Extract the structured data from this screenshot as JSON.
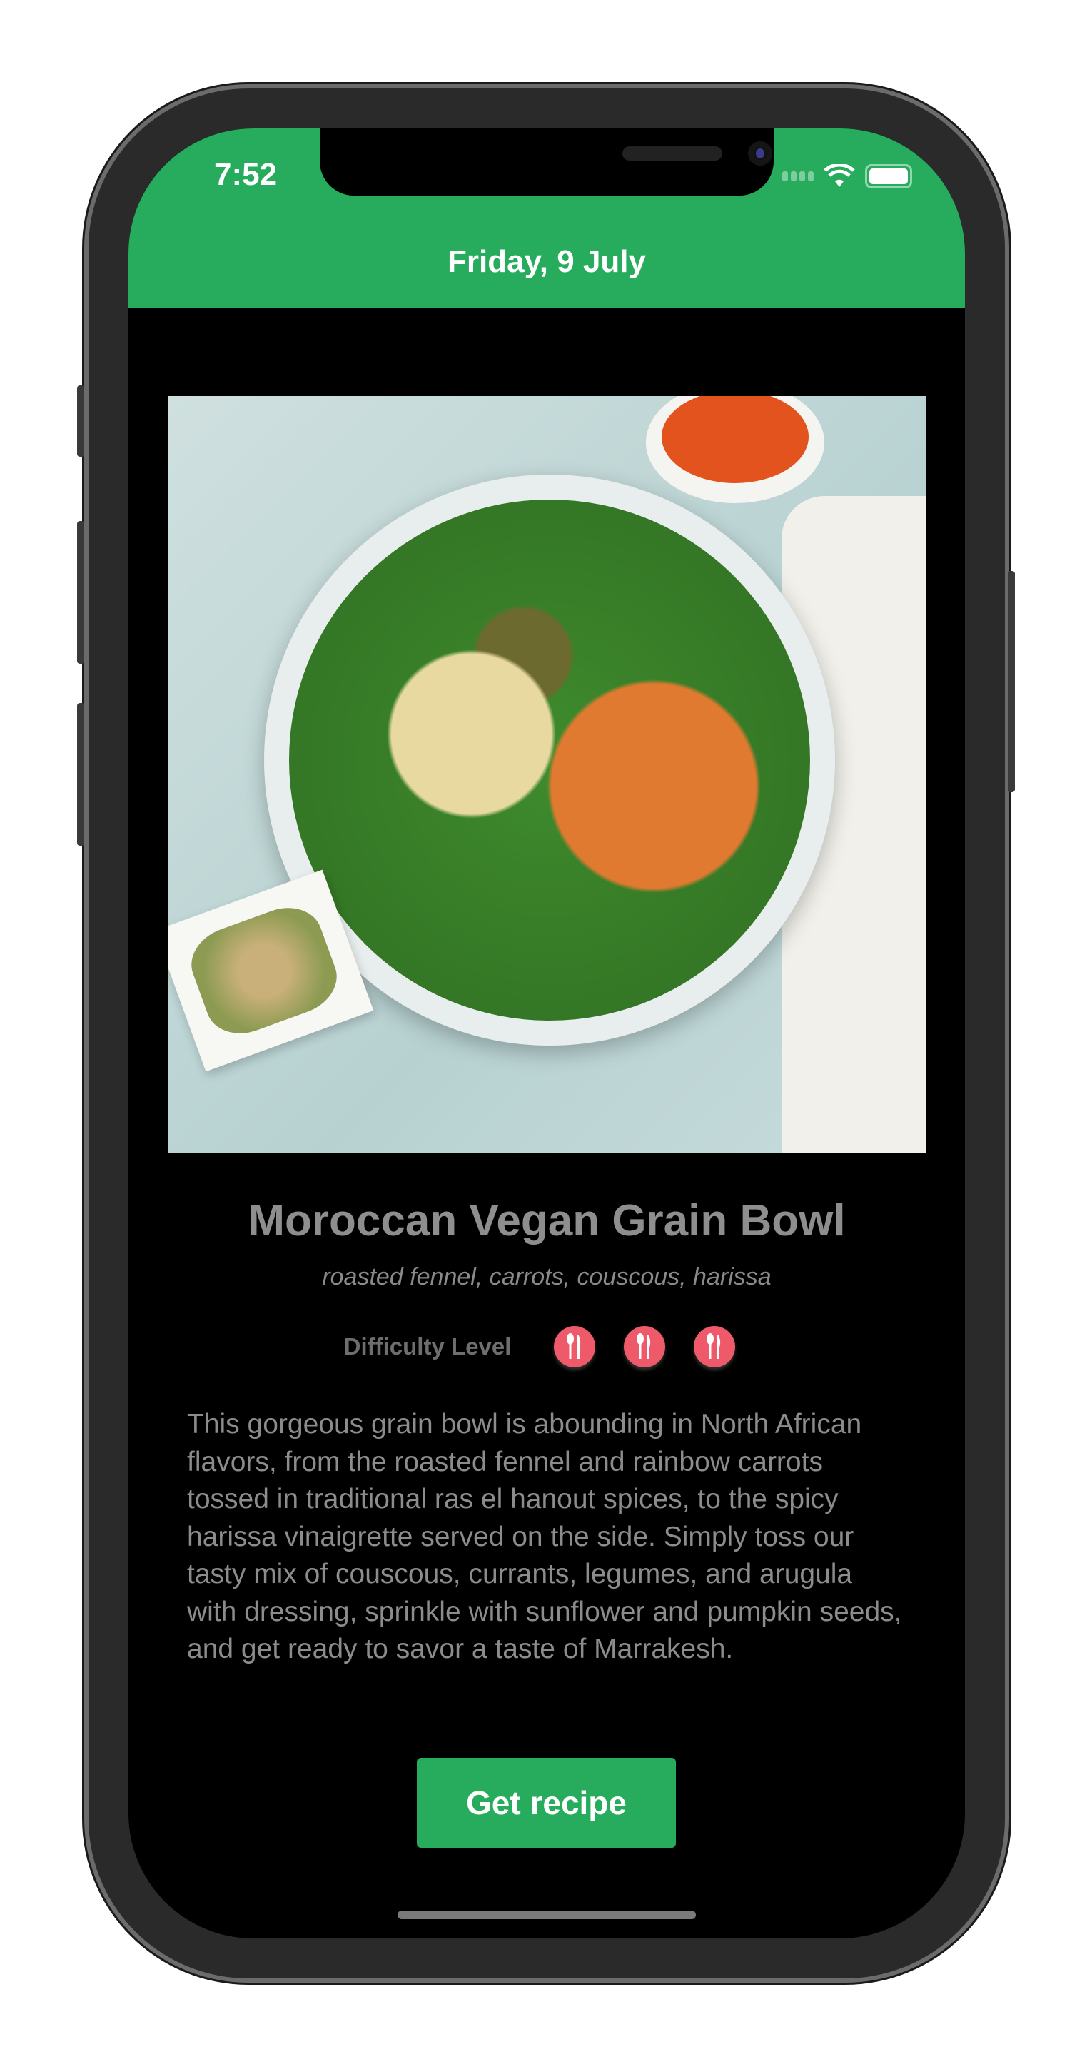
{
  "status_bar": {
    "time": "7:52"
  },
  "header": {
    "date": "Friday, 9 July"
  },
  "recipe": {
    "title": "Moroccan Vegan Grain Bowl",
    "subtitle": "roasted fennel, carrots, couscous, harissa",
    "difficulty_label": "Difficulty Level",
    "difficulty_level": 3,
    "difficulty_max": 3,
    "description": "This gorgeous grain bowl is abounding in North African flavors, from the roasted fennel and rainbow carrots tossed in traditional ras el hanout spices, to the spicy harissa vinaigrette served on the side. Simply toss our tasty mix of couscous, currants, legumes, and arugula with dressing, sprinkle with sunflower and pumpkin seeds, and get ready to savor a taste of Marrakesh.",
    "cta_label": "Get recipe"
  },
  "colors": {
    "accent": "#27ac5e",
    "difficulty": "#ee5a6a"
  }
}
